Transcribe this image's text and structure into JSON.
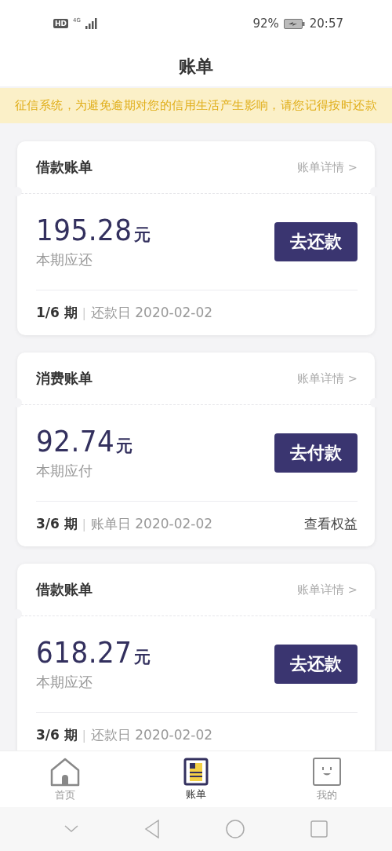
{
  "status_bar": {
    "hd": "HD",
    "network": "4G",
    "battery": "92%",
    "time": "20:57"
  },
  "header": {
    "title": "账单"
  },
  "notice": "征信系统，为避免逾期对您的信用生活产生影响，请您记得按时还款",
  "bills": [
    {
      "title": "借款账单",
      "detail_link": "账单详情 >",
      "amount": "195.28",
      "unit": "元",
      "amount_label": "本期应还",
      "action": "去还款",
      "period": "1/6 期",
      "separator": "|",
      "due": "还款日 2020-02-02"
    },
    {
      "title": "消费账单",
      "detail_link": "账单详情 >",
      "amount": "92.74",
      "unit": "元",
      "amount_label": "本期应付",
      "action": "去付款",
      "period": "3/6 期",
      "separator": "|",
      "due": "账单日 2020-02-02",
      "extra_link": "查看权益"
    },
    {
      "title": "借款账单",
      "detail_link": "账单详情 >",
      "amount": "618.27",
      "unit": "元",
      "amount_label": "本期应还",
      "action": "去还款",
      "period": "3/6 期",
      "separator": "|",
      "due": "还款日 2020-02-02"
    }
  ],
  "tabs": [
    {
      "kind": "home",
      "label": "首页",
      "selected": false
    },
    {
      "kind": "bill",
      "label": "账单",
      "selected": true
    },
    {
      "kind": "profile",
      "label": "我的",
      "selected": false
    }
  ]
}
